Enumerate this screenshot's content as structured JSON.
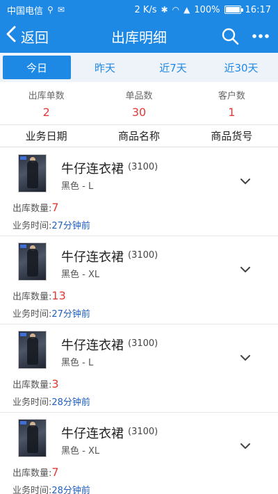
{
  "status_bar": {
    "carrier": "中国电信",
    "speed": "2 K/s",
    "battery": "100%",
    "battery_fraction": 1.0,
    "time": "16:17"
  },
  "header": {
    "back_label": "返回",
    "title": "出库明细",
    "search_icon": "search-icon",
    "more_icon": "more-icon"
  },
  "tabs": [
    {
      "label": "今日",
      "active": true
    },
    {
      "label": "昨天",
      "active": false
    },
    {
      "label": "近7天",
      "active": false
    },
    {
      "label": "近30天",
      "active": false
    }
  ],
  "summary": [
    {
      "label": "出库单数",
      "value": "2"
    },
    {
      "label": "单品数",
      "value": "30"
    },
    {
      "label": "客户数",
      "value": "1"
    }
  ],
  "columns": [
    "业务日期",
    "商品名称",
    "商品货号"
  ],
  "labels": {
    "qty": "出库数量:",
    "time": "业务时间:"
  },
  "items": [
    {
      "name": "牛仔连衣裙",
      "code": "(3100)",
      "spec": "黑色 - L",
      "qty": "7",
      "time": "27分钟前"
    },
    {
      "name": "牛仔连衣裙",
      "code": "(3100)",
      "spec": "黑色 - XL",
      "qty": "13",
      "time": "27分钟前"
    },
    {
      "name": "牛仔连衣裙",
      "code": "(3100)",
      "spec": "黑色 - L",
      "qty": "3",
      "time": "28分钟前"
    },
    {
      "name": "牛仔连衣裙",
      "code": "(3100)",
      "spec": "黑色 - XL",
      "qty": "7",
      "time": "28分钟前"
    }
  ],
  "colors": {
    "primary": "#1e88e5",
    "accent_red": "#e53935",
    "time_blue": "#1e5fc0"
  }
}
